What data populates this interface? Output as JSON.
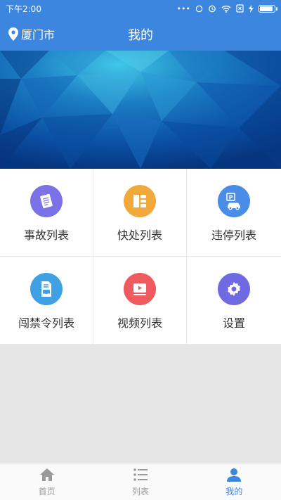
{
  "status": {
    "time": "下午2:00",
    "battery_level": 0.9
  },
  "header": {
    "location": "厦门市",
    "title": "我的"
  },
  "menu": [
    {
      "label": "事故列表",
      "icon": "accident-list-icon",
      "color": "#7a72e6"
    },
    {
      "label": "快处列表",
      "icon": "quick-handle-list-icon",
      "color": "#f2a93b"
    },
    {
      "label": "违停列表",
      "icon": "parking-violation-icon",
      "color": "#4a8de6"
    },
    {
      "label": "闯禁令列表",
      "icon": "restriction-violation-icon",
      "color": "#3fa0e3"
    },
    {
      "label": "视频列表",
      "icon": "video-list-icon",
      "color": "#ee5a5e"
    },
    {
      "label": "设置",
      "icon": "settings-gear-icon",
      "color": "#6f6ae2"
    }
  ],
  "nav": [
    {
      "label": "首页",
      "icon": "home-icon",
      "active": false
    },
    {
      "label": "列表",
      "icon": "list-icon",
      "active": false
    },
    {
      "label": "我的",
      "icon": "user-icon",
      "active": true
    }
  ],
  "colors": {
    "primary": "#3d86e0",
    "inactive": "#999999"
  }
}
